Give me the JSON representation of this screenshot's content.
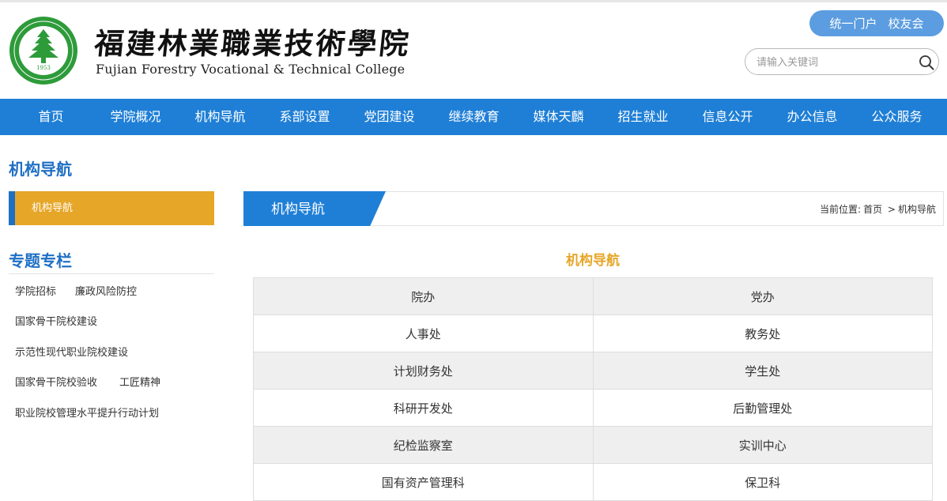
{
  "header": {
    "logo_year": "1953",
    "title_cn": "福建林業職業技術學院",
    "title_en": "Fujian Forestry Vocational & Technical College",
    "portal_links": [
      "统一门户",
      "校友会"
    ],
    "search_placeholder": "请输入关键词",
    "brand_blue": "#1f7fd6",
    "logo_green": "#2e9b3a"
  },
  "nav": {
    "items": [
      "首页",
      "学院概况",
      "机构导航",
      "系部设置",
      "党团建设",
      "继续教育",
      "媒体天麟",
      "招生就业",
      "信息公开",
      "办公信息",
      "公众服务"
    ]
  },
  "sidebar": {
    "section_title": "机构导航",
    "active_item": "机构导航",
    "special_title": "专题专栏",
    "special_links": [
      "学院招标",
      "廉政风险防控",
      "国家骨干院校建设",
      "示范性现代职业院校建设",
      "国家骨干院校验收",
      "工匠精神",
      "职业院校管理水平提升行动计划"
    ]
  },
  "main": {
    "tab_label": "机构导航",
    "breadcrumb": {
      "prefix": "当前位置:",
      "home": "首页",
      "separator": ">",
      "current": "机构导航"
    },
    "content_title": "机构导航",
    "accent": "#e6a628",
    "rows": [
      [
        "院办",
        "党办"
      ],
      [
        "人事处",
        "教务处"
      ],
      [
        "计划财务处",
        "学生处"
      ],
      [
        "科研开发处",
        "后勤管理处"
      ],
      [
        "纪检监察室",
        "实训中心"
      ],
      [
        "国有资产管理科",
        "保卫科"
      ]
    ]
  }
}
